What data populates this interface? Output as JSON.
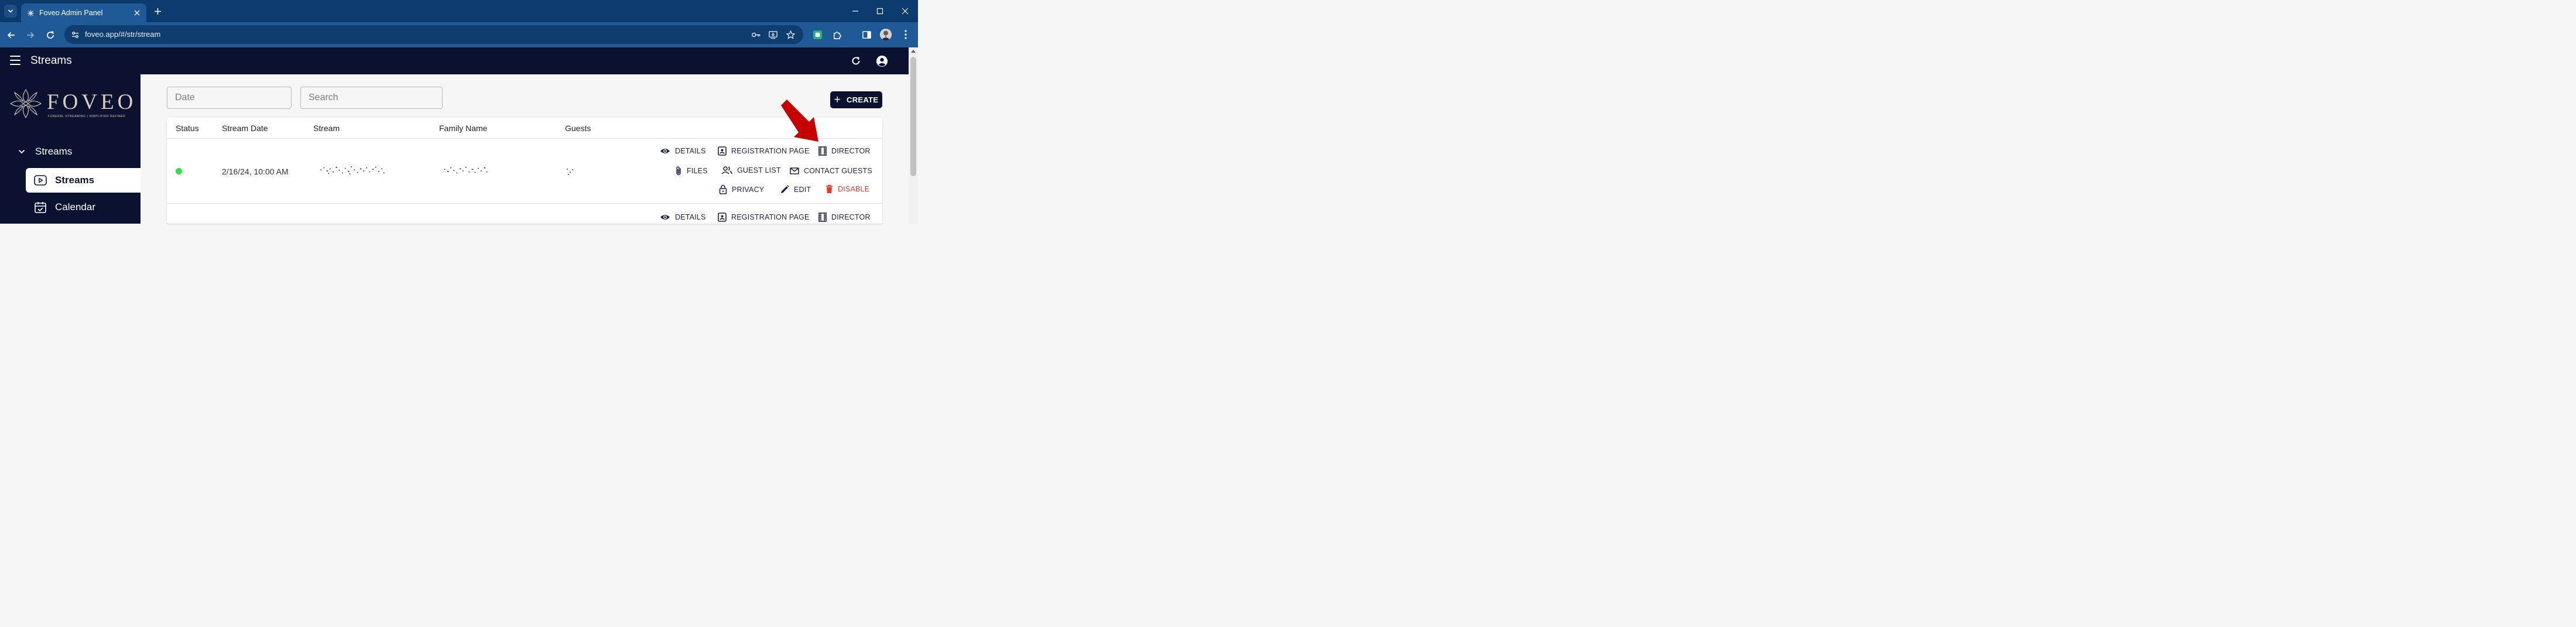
{
  "browser": {
    "tab_title": "Foveo Admin Panel",
    "url": "foveo.app/#/str/stream"
  },
  "app": {
    "header_title": "Streams"
  },
  "sidebar": {
    "logo_text": "FOVEO",
    "logo_tagline": "FUNERAL STREAMING | SIMPLIFIED REFINED",
    "section_label": "Streams",
    "items": [
      {
        "label": "Streams",
        "icon": "play-icon",
        "active": true
      },
      {
        "label": "Calendar",
        "icon": "calendar-icon",
        "active": false
      }
    ]
  },
  "filters": {
    "date_placeholder": "Date",
    "search_placeholder": "Search",
    "create_label": "CREATE"
  },
  "table": {
    "columns": [
      "Status",
      "Stream Date",
      "Stream",
      "Family Name",
      "Guests"
    ],
    "rows": [
      {
        "status": "active",
        "stream_date": "2/16/24, 10:00 AM",
        "actions": {
          "details": "DETAILS",
          "registration_page": "REGISTRATION PAGE",
          "director": "DIRECTOR",
          "files": "FILES",
          "guest_list": "GUEST LIST",
          "contact_guests": "CONTACT GUESTS",
          "privacy": "PRIVACY",
          "edit": "EDIT",
          "disable": "DISABLE"
        }
      },
      {
        "actions": {
          "details": "DETAILS",
          "registration_page": "REGISTRATION PAGE",
          "director": "DIRECTOR"
        }
      }
    ]
  },
  "colors": {
    "chrome_dark": "#0b3a6e",
    "chrome_toolbar": "#1f5a96",
    "app_navy": "#0b1230",
    "status_active": "#2ee04a",
    "danger": "#e53935",
    "annotation_arrow": "#c40000"
  }
}
